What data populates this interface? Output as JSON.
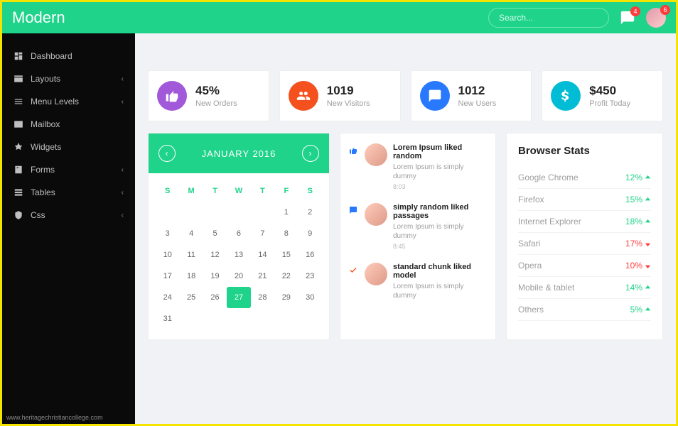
{
  "header": {
    "brand": "Modern",
    "search_placeholder": "Search...",
    "chat_badge": "4",
    "avatar_badge": "6"
  },
  "sidebar": {
    "items": [
      {
        "label": "Dashboard",
        "icon": "dash",
        "expandable": false
      },
      {
        "label": "Layouts",
        "icon": "layout",
        "expandable": true
      },
      {
        "label": "Menu Levels",
        "icon": "menu",
        "expandable": true
      },
      {
        "label": "Mailbox",
        "icon": "mail",
        "expandable": false
      },
      {
        "label": "Widgets",
        "icon": "widget",
        "expandable": false
      },
      {
        "label": "Forms",
        "icon": "form",
        "expandable": true
      },
      {
        "label": "Tables",
        "icon": "table",
        "expandable": true
      },
      {
        "label": "Css",
        "icon": "css",
        "expandable": true
      }
    ]
  },
  "cards": [
    {
      "value": "45%",
      "label": "New Orders",
      "color": "purple",
      "icon": "thumb"
    },
    {
      "value": "1019",
      "label": "New Visitors",
      "color": "orange",
      "icon": "users"
    },
    {
      "value": "1012",
      "label": "New Users",
      "color": "blue",
      "icon": "comment"
    },
    {
      "value": "$450",
      "label": "Profit Today",
      "color": "cyan",
      "icon": "dollar"
    }
  ],
  "calendar": {
    "title": "JANUARY 2016",
    "dow": [
      "S",
      "M",
      "T",
      "W",
      "T",
      "F",
      "S"
    ],
    "weeks": [
      [
        "",
        "",
        "",
        "",
        "",
        "1",
        "2"
      ],
      [
        "3",
        "4",
        "5",
        "6",
        "7",
        "8",
        "9"
      ],
      [
        "10",
        "11",
        "12",
        "13",
        "14",
        "15",
        "16"
      ],
      [
        "17",
        "18",
        "19",
        "20",
        "21",
        "22",
        "23"
      ],
      [
        "24",
        "25",
        "26",
        "27",
        "28",
        "29",
        "30"
      ],
      [
        "31",
        "",
        "",
        "",
        "",
        "",
        ""
      ]
    ],
    "selected": "27"
  },
  "feed": [
    {
      "icon": "thumb",
      "title": "Lorem Ipsum liked random",
      "sub": "Lorem Ipsum is simply dummy",
      "time": "8:03"
    },
    {
      "icon": "comment",
      "title": "simply random liked passages",
      "sub": "Lorem Ipsum is simply dummy",
      "time": "8:45"
    },
    {
      "icon": "check",
      "title": "standard chunk liked model",
      "sub": "Lorem Ipsum is simply dummy",
      "time": ""
    }
  ],
  "stats": {
    "title": "Browser Stats",
    "rows": [
      {
        "name": "Google Chrome",
        "val": "12%",
        "trend": "up",
        "color": "green"
      },
      {
        "name": "Firefox",
        "val": "15%",
        "trend": "up",
        "color": "green"
      },
      {
        "name": "Internet Explorer",
        "val": "18%",
        "trend": "up",
        "color": "green"
      },
      {
        "name": "Safari",
        "val": "17%",
        "trend": "down",
        "color": "red"
      },
      {
        "name": "Opera",
        "val": "10%",
        "trend": "down",
        "color": "red"
      },
      {
        "name": "Mobile & tablet",
        "val": "14%",
        "trend": "up",
        "color": "green"
      },
      {
        "name": "Others",
        "val": "5%",
        "trend": "up",
        "color": "green"
      }
    ]
  },
  "watermark": "www.heritagechristiancollege.com"
}
